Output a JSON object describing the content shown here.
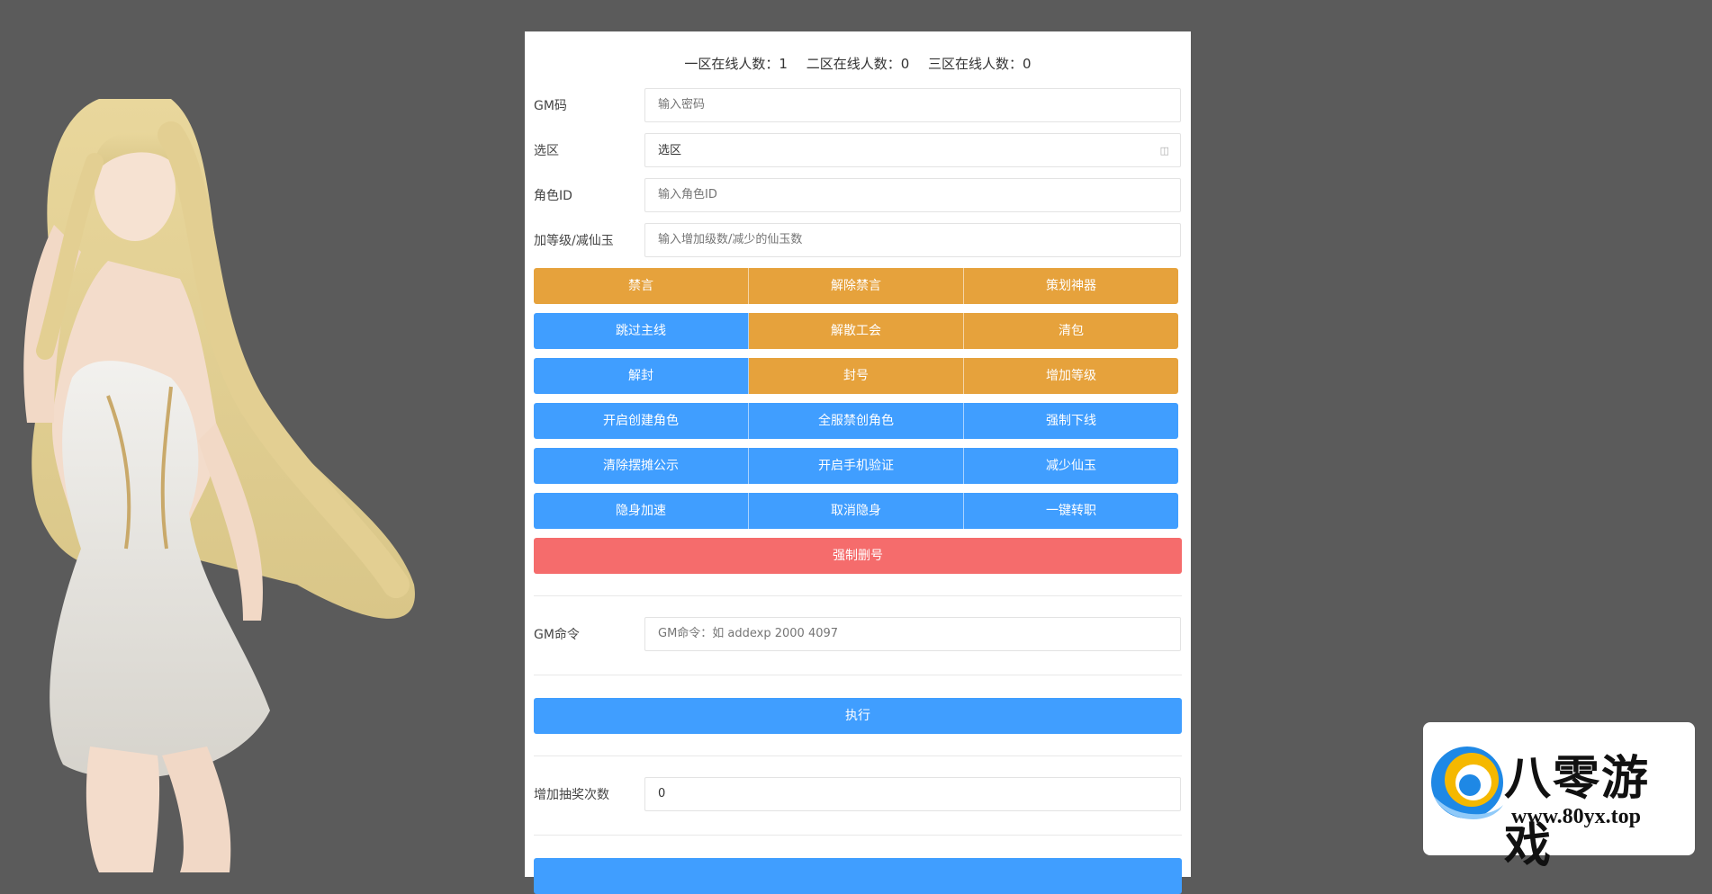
{
  "online": {
    "zone1": "一区在线人数：1",
    "zone2": "二区在线人数：0",
    "zone3": "三区在线人数：0"
  },
  "form": {
    "gm_code": {
      "label": "GM码",
      "placeholder": "输入密码"
    },
    "zone": {
      "label": "选区",
      "value": "选区"
    },
    "role_id": {
      "label": "角色ID",
      "placeholder": "输入角色ID"
    },
    "level": {
      "label": "加等级/减仙玉",
      "placeholder": "输入增加级数/减少的仙玉数"
    }
  },
  "buttons": [
    [
      {
        "label": "禁言",
        "color": "orange"
      },
      {
        "label": "解除禁言",
        "color": "orange"
      },
      {
        "label": "策划神器",
        "color": "orange"
      }
    ],
    [
      {
        "label": "跳过主线",
        "color": "blue"
      },
      {
        "label": "解散工会",
        "color": "orange"
      },
      {
        "label": "清包",
        "color": "orange"
      }
    ],
    [
      {
        "label": "解封",
        "color": "blue"
      },
      {
        "label": "封号",
        "color": "orange"
      },
      {
        "label": "增加等级",
        "color": "orange"
      }
    ],
    [
      {
        "label": "开启创建角色",
        "color": "blue"
      },
      {
        "label": "全服禁创角色",
        "color": "blue"
      },
      {
        "label": "强制下线",
        "color": "blue"
      }
    ],
    [
      {
        "label": "清除摆摊公示",
        "color": "blue"
      },
      {
        "label": "开启手机验证",
        "color": "blue"
      },
      {
        "label": "减少仙玉",
        "color": "blue"
      }
    ],
    [
      {
        "label": "隐身加速",
        "color": "blue"
      },
      {
        "label": "取消隐身",
        "color": "blue"
      },
      {
        "label": "一键转职",
        "color": "blue"
      }
    ]
  ],
  "force_delete": "强制删号",
  "gm_command": {
    "label": "GM命令",
    "placeholder": "GM命令：如 addexp 2000 4097"
  },
  "execute": "执行",
  "lottery": {
    "label": "增加抽奖次数",
    "value": "0"
  },
  "logo": {
    "title": "八零游戏",
    "url": "www.80yx.top"
  },
  "colors": {
    "orange": "#e6a23c",
    "blue": "#409eff",
    "red": "#f56c6c",
    "background": "#5b5b5b"
  }
}
